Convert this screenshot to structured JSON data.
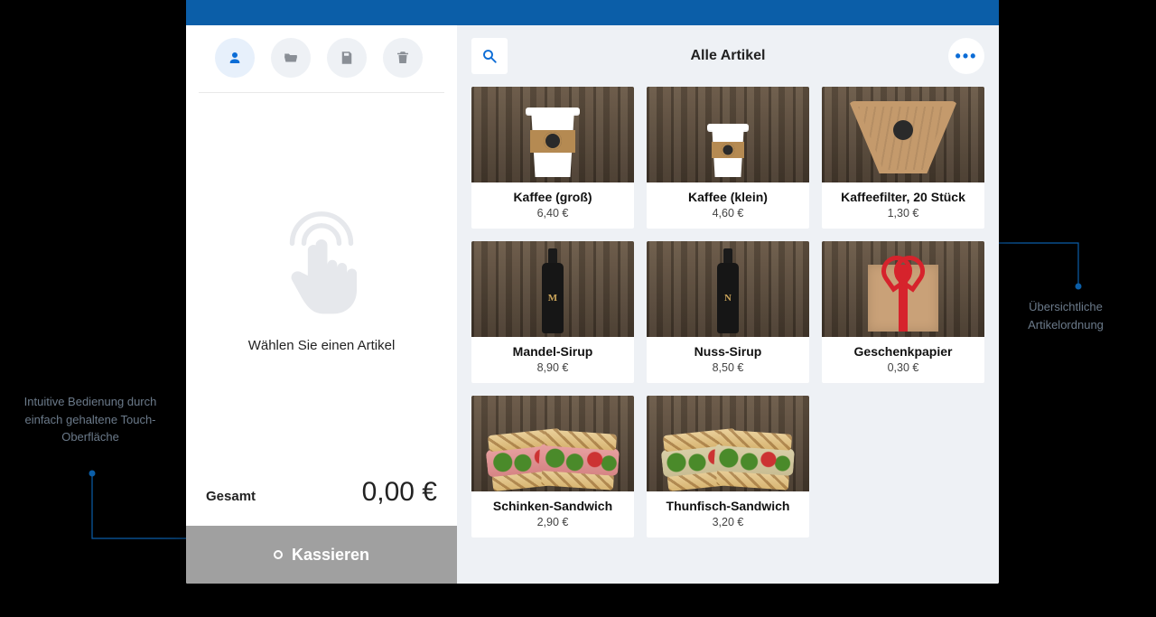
{
  "annotations": {
    "left": "Intuitive Bedienung durch einfach gehaltene Touch-Oberfläche",
    "right": "Übersichtliche Artikelordnung"
  },
  "sidebar": {
    "empty_prompt": "Wählen Sie einen Artikel",
    "total_label": "Gesamt",
    "total_amount": "0,00 €",
    "checkout_label": "Kassieren"
  },
  "main": {
    "header_title": "Alle Artikel"
  },
  "products": [
    {
      "name": "Kaffee (groß)",
      "price": "6,40 €",
      "visual": "cup-lg"
    },
    {
      "name": "Kaffee (klein)",
      "price": "4,60 €",
      "visual": "cup-sm"
    },
    {
      "name": "Kaffeefilter, 20 Stück",
      "price": "1,30 €",
      "visual": "filter"
    },
    {
      "name": "Mandel-Sirup",
      "price": "8,90 €",
      "visual": "bottle-m"
    },
    {
      "name": "Nuss-Sirup",
      "price": "8,50 €",
      "visual": "bottle-n"
    },
    {
      "name": "Geschenkpapier",
      "price": "0,30 €",
      "visual": "gift"
    },
    {
      "name": "Schinken-Sandwich",
      "price": "2,90 €",
      "visual": "sandwich-ham"
    },
    {
      "name": "Thunfisch-Sandwich",
      "price": "3,20 €",
      "visual": "sandwich-tuna"
    }
  ]
}
